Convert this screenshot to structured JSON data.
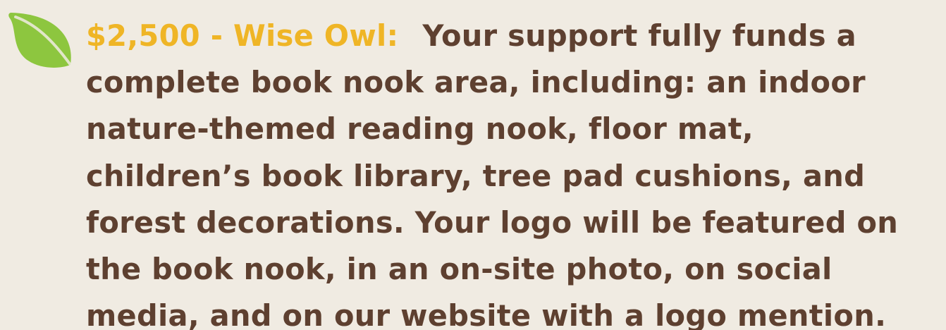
{
  "tier": {
    "label": "$2,500 - Wise Owl:",
    "accent_color": "#efb526"
  },
  "description": {
    "lines": [
      "Your support fully funds a",
      "complete book nook area, including: an indoor",
      "nature-themed reading nook, floor mat,",
      "children’s book library, tree pad cushions, and",
      "forest decorations. Your logo will be featured on",
      "the book nook, in an on-site photo, on social",
      "media, and on our website with a logo mention."
    ],
    "text_color": "#5e4030"
  },
  "icon": {
    "name": "leaf-icon",
    "color": "#8dc63f"
  },
  "background_color": "#f0ebe2"
}
